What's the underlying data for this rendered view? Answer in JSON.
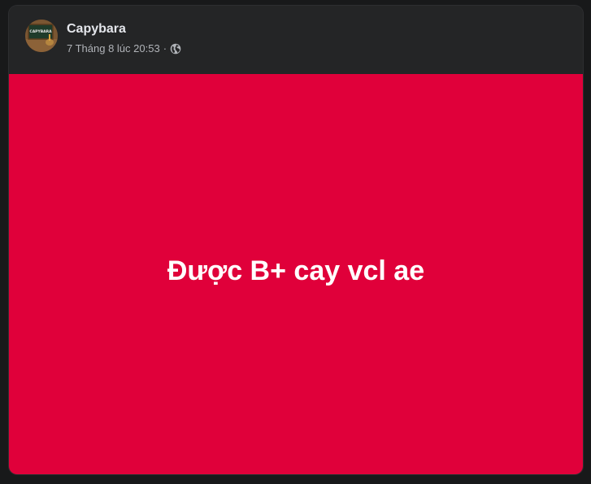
{
  "post": {
    "author": "Capybara",
    "avatar_icon": "capybara-chalkboard-avatar",
    "avatar_label": "CAPYBARA",
    "timestamp": "7 Tháng 8 lúc 20:53",
    "separator": "·",
    "privacy_icon": "globe-icon",
    "text": "Được B+ cay vcl ae",
    "background_color": "#e0003a",
    "text_color": "#ffffff"
  }
}
